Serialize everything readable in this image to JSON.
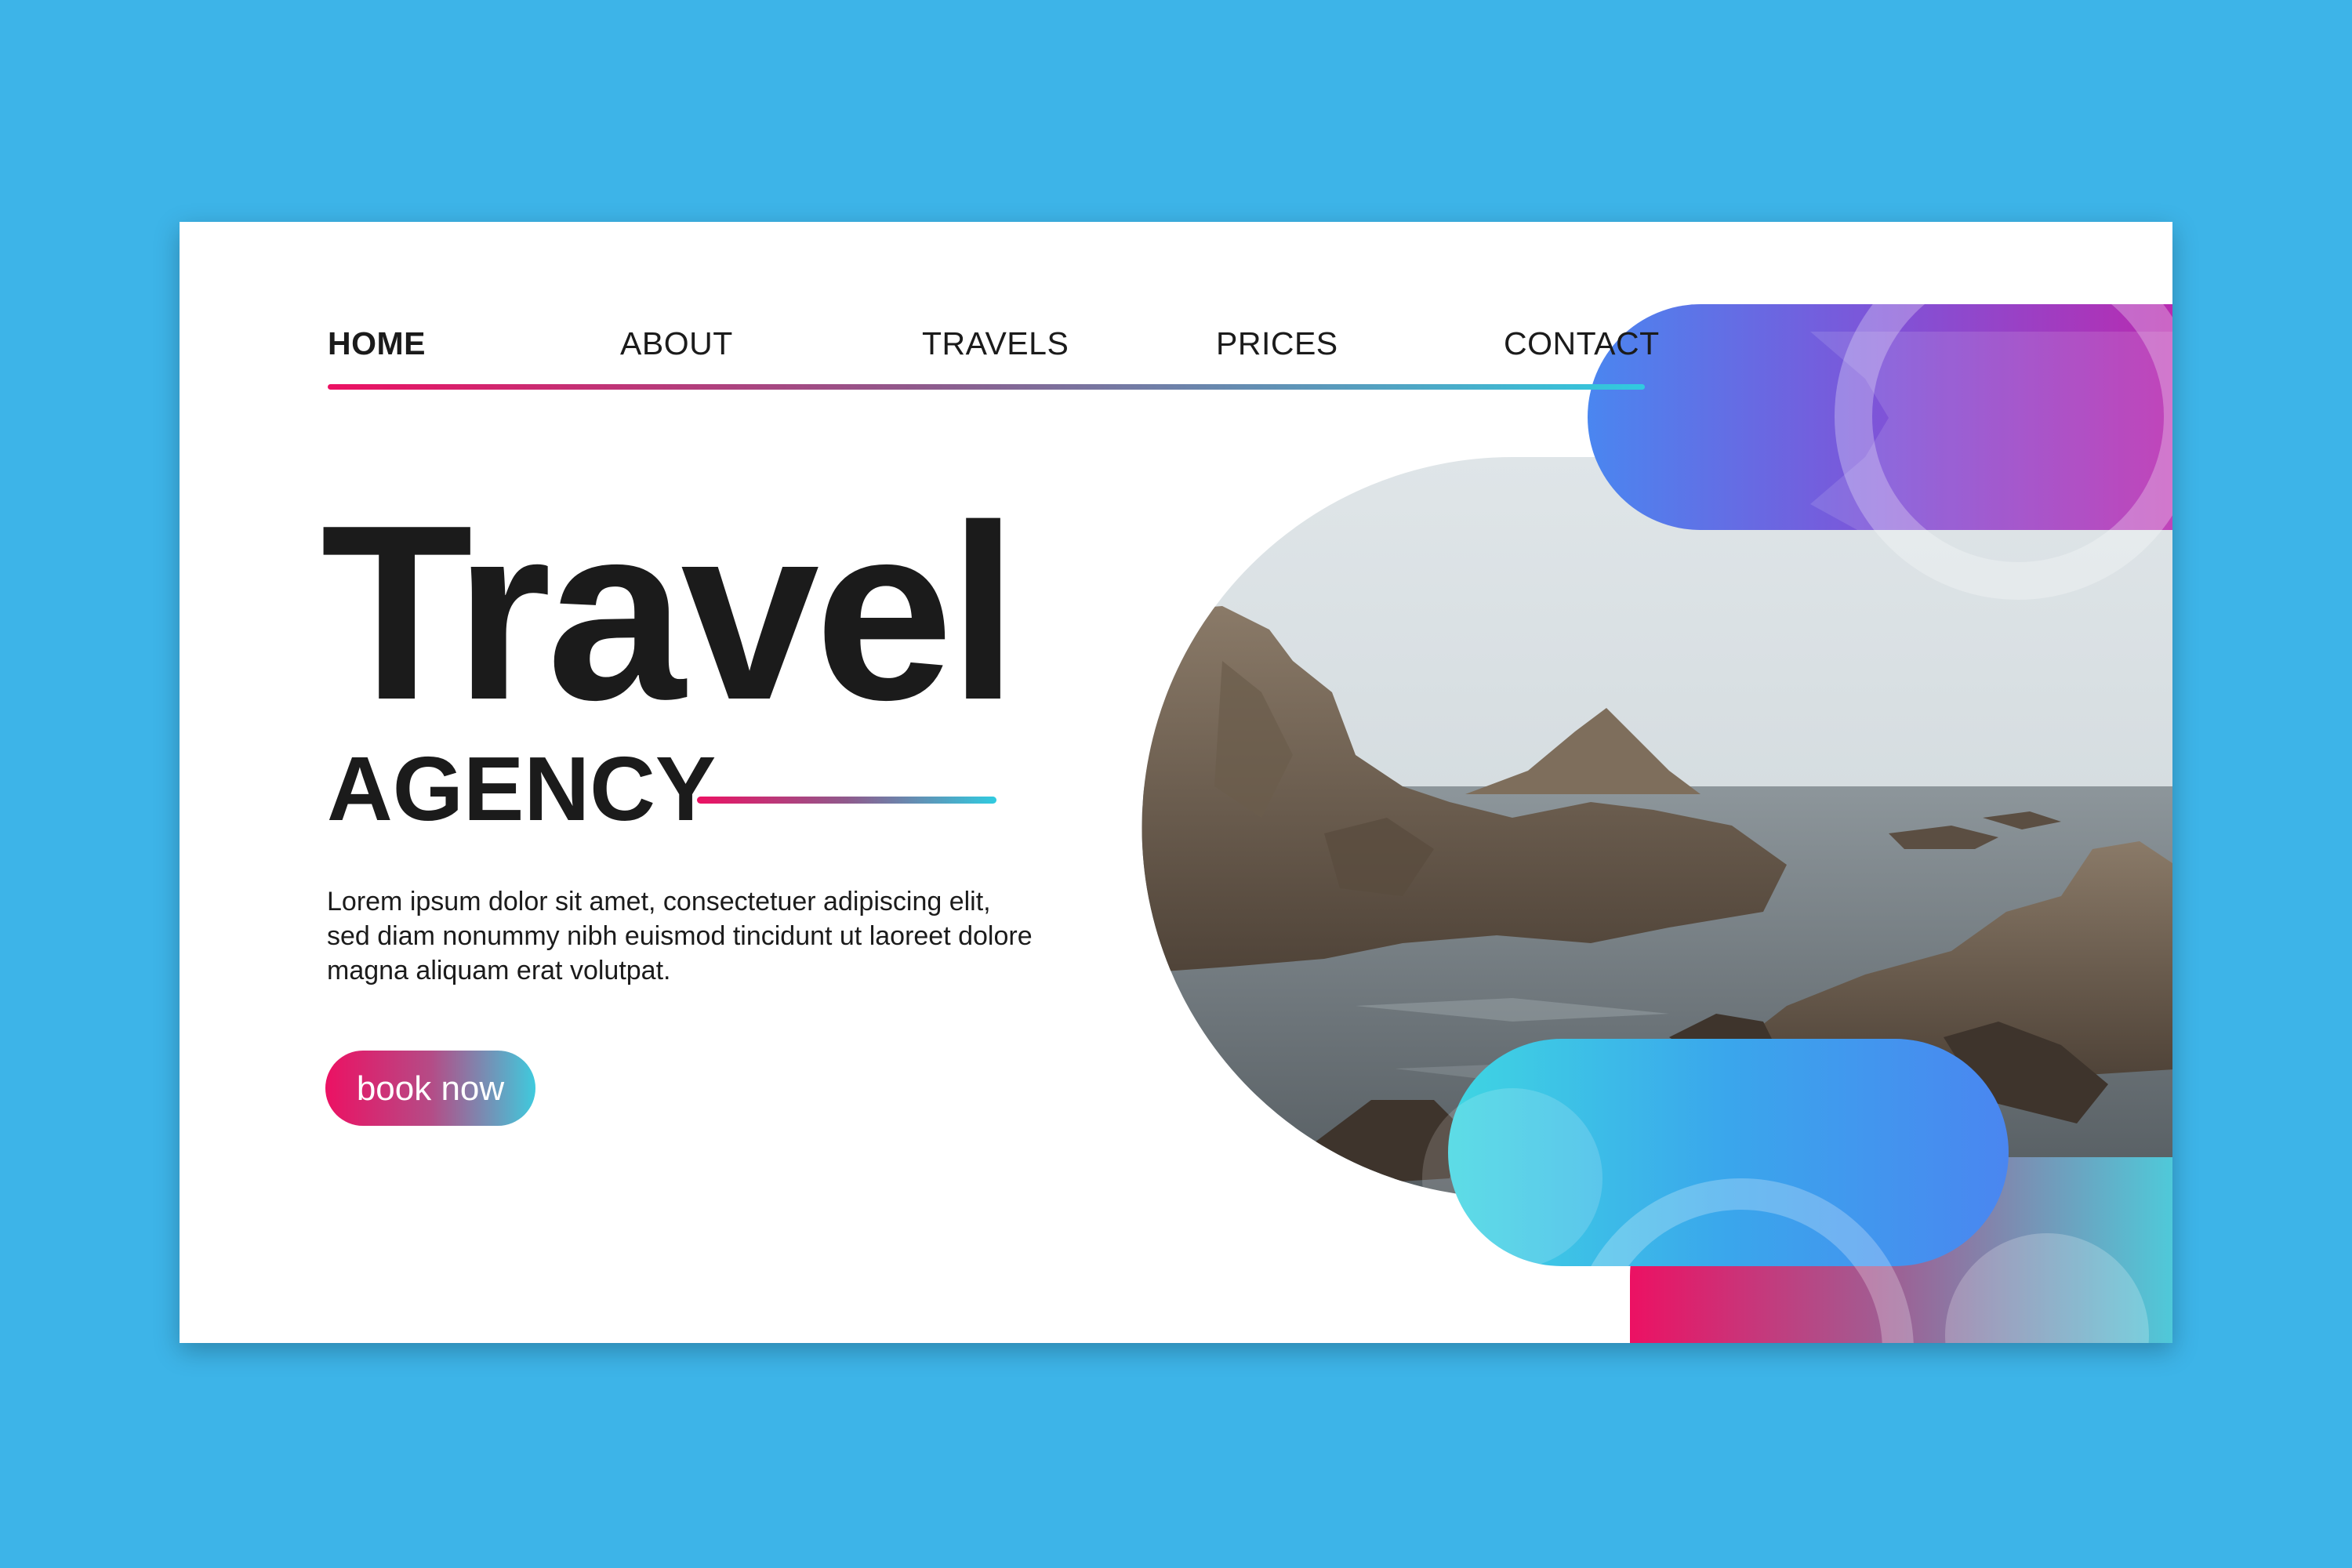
{
  "nav": {
    "items": [
      {
        "label": "HOME",
        "active": true
      },
      {
        "label": "ABOUT",
        "active": false
      },
      {
        "label": "TRAVELS",
        "active": false
      },
      {
        "label": "PRICES",
        "active": false
      },
      {
        "label": "CONTACT",
        "active": false
      }
    ]
  },
  "hero": {
    "title": "Travel",
    "subtitle": "AGENCY",
    "description": "Lorem ipsum dolor sit amet, consectetuer adipiscing elit, sed diam nonummy nibh euismod tincidunt ut laoreet dolore magna aliquam erat volutpat.",
    "cta_label": "book now"
  },
  "colors": {
    "background": "#3db4e8",
    "card": "#ffffff",
    "text": "#1b1b1b",
    "gradient_pink": "#ec1163",
    "gradient_cyan": "#30cbe0",
    "gradient_blue": "#4a86f0",
    "gradient_purple": "#b82bb0"
  }
}
